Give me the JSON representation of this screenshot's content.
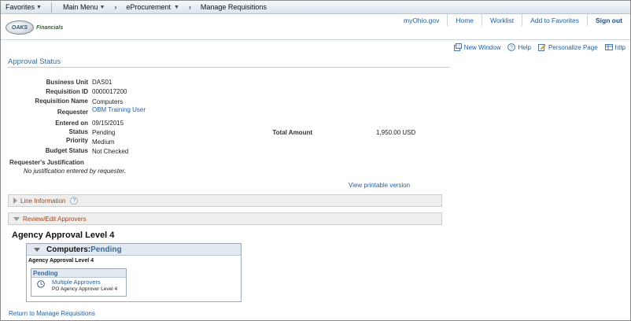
{
  "navbar": {
    "favorites": "Favorites",
    "main_menu": "Main Menu",
    "eprocurement": "eProcurement",
    "current": "Manage Requisitions"
  },
  "header": {
    "logo_text": "OAKS",
    "logo_sub": "Financials",
    "links": [
      "myOhio.gov",
      "Home",
      "Worklist",
      "Add to Favorites",
      "Sign out"
    ]
  },
  "tools": {
    "new_window": "New Window",
    "help": "Help",
    "personalize": "Personalize Page",
    "http": "http"
  },
  "page_title": "Approval Status",
  "fields": {
    "business_unit_label": "Business Unit",
    "business_unit": "DAS01",
    "requisition_id_label": "Requisition ID",
    "requisition_id": "0000017200",
    "requisition_name_label": "Requisition Name",
    "requisition_name": "Computers",
    "requester_label": "Requester",
    "requester": "OBM Training User",
    "entered_on_label": "Entered on",
    "entered_on": "09/15/2015",
    "status_label": "Status",
    "status": "Pending",
    "priority_label": "Priority",
    "priority": "Medium",
    "budget_status_label": "Budget Status",
    "budget_status": "Not Checked",
    "total_amount_label": "Total Amount",
    "total_amount": "1,950.00 USD"
  },
  "justification": {
    "label": "Requester's Justification",
    "text": "No justification entered by requester."
  },
  "view_printable": "View printable version",
  "sections": {
    "line_information": "Line Information",
    "review_edit": "Review/Edit Approvers"
  },
  "approval": {
    "level_title": "Agency Approval Level 4",
    "box_name": "Computers:",
    "box_status": "Pending",
    "sub_title": "Agency Approval Level 4",
    "pending_label": "Pending",
    "approver_name": "Multiple Approvers",
    "approver_role": "PO Agency Approver Level 4"
  },
  "return_link": "Return to Manage Requisitions",
  "colors": {
    "link": "#1f5fa8",
    "section_text": "#a6441b",
    "header_blue": "#3a6a9c"
  }
}
